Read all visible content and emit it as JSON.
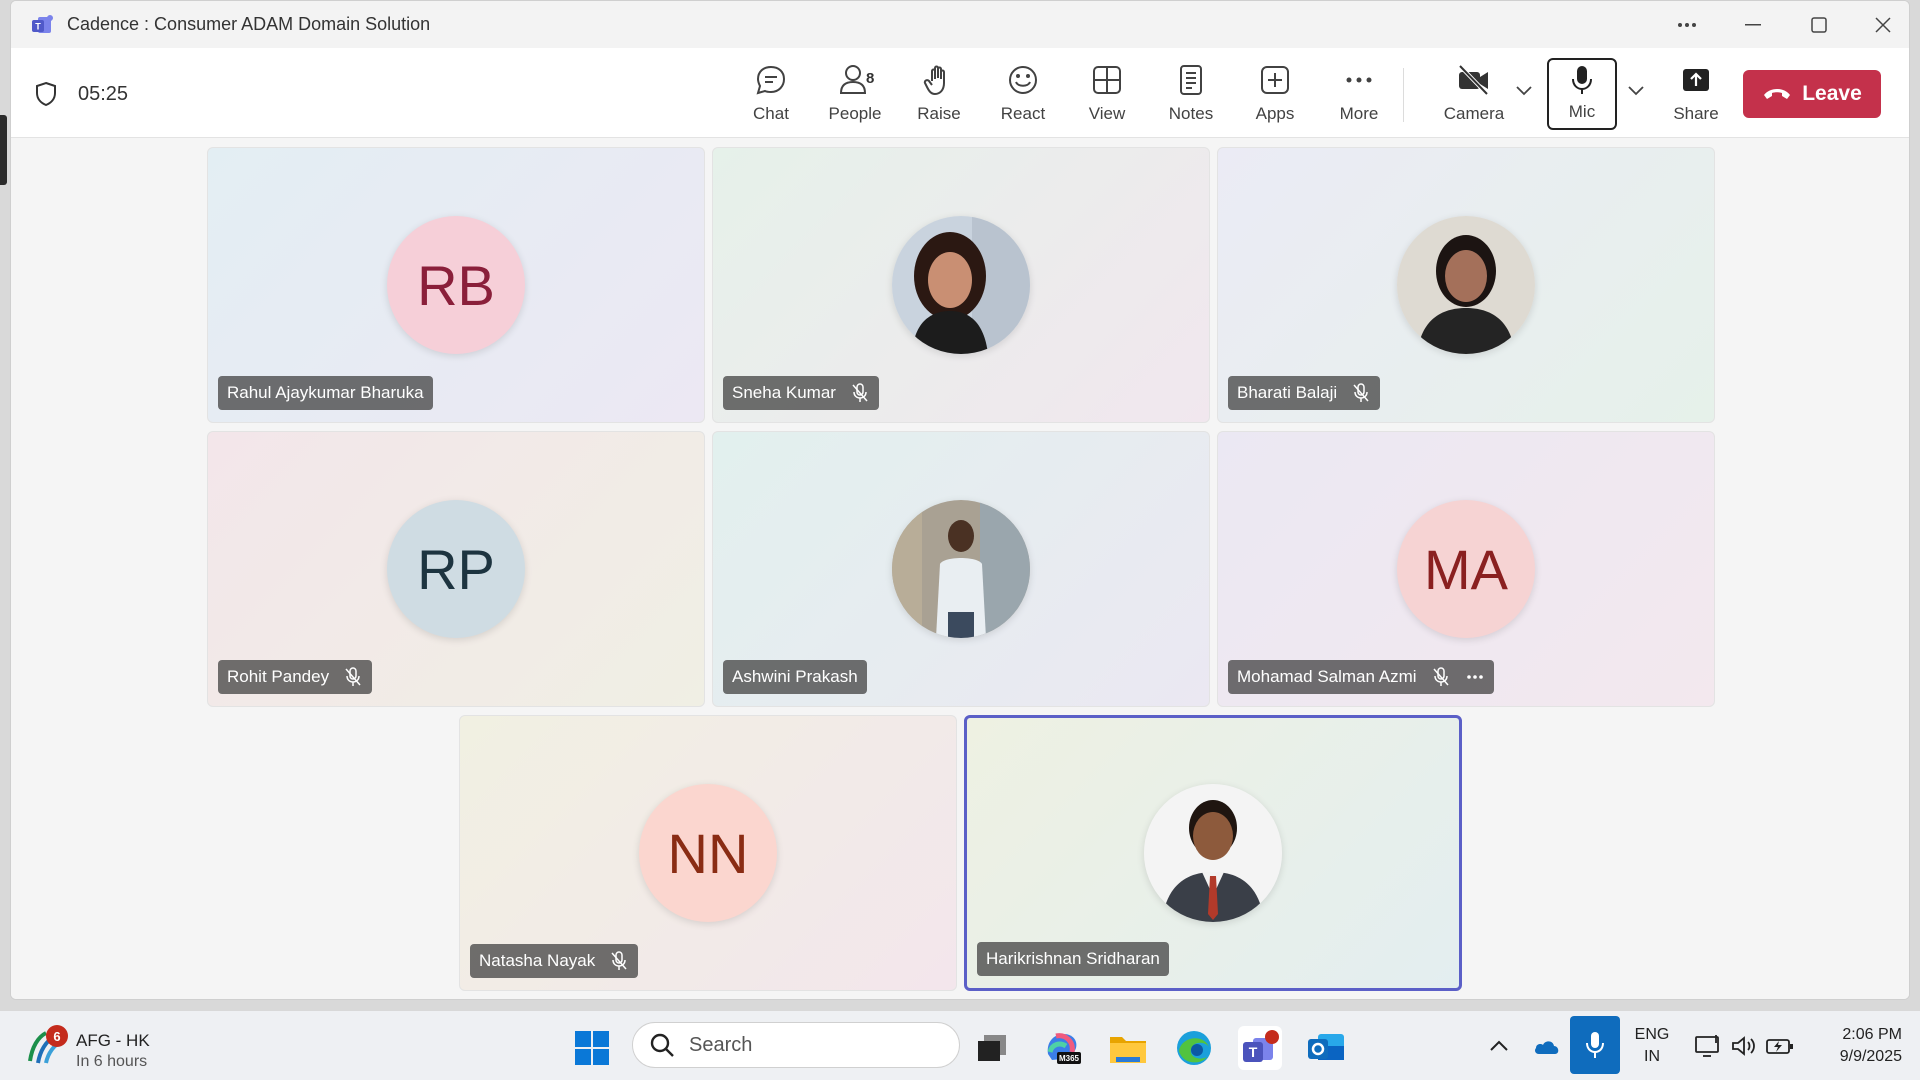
{
  "window": {
    "title": "Cadence : Consumer ADAM Domain Solution"
  },
  "meeting": {
    "timer": "05:25"
  },
  "toolbar": {
    "chat": "Chat",
    "people": "People",
    "people_count": "8",
    "raise": "Raise",
    "react": "React",
    "view": "View",
    "notes": "Notes",
    "apps": "Apps",
    "more": "More",
    "camera": "Camera",
    "mic": "Mic",
    "share": "Share",
    "leave": "Leave"
  },
  "participants": [
    {
      "name": "Rahul Ajaykumar Bharuka",
      "initials": "RB",
      "muted": false,
      "photo": false,
      "avatar_bg": "#f6cfd8",
      "avatar_fg": "#8a1f3a"
    },
    {
      "name": "Sneha Kumar",
      "initials": "",
      "muted": true,
      "photo": true
    },
    {
      "name": "Bharati Balaji",
      "initials": "",
      "muted": true,
      "photo": true
    },
    {
      "name": "Rohit Pandey",
      "initials": "RP",
      "muted": true,
      "photo": false,
      "avatar_bg": "#cfdce3",
      "avatar_fg": "#1d3440"
    },
    {
      "name": "Ashwini Prakash",
      "initials": "",
      "muted": false,
      "photo": true
    },
    {
      "name": "Mohamad Salman Azmi",
      "initials": "MA",
      "muted": true,
      "photo": false,
      "avatar_bg": "#f6d3d3",
      "avatar_fg": "#8a2020"
    },
    {
      "name": "Natasha Nayak",
      "initials": "NN",
      "muted": true,
      "photo": false,
      "avatar_bg": "#fbd6cf",
      "avatar_fg": "#8a2c14"
    },
    {
      "name": "Harikrishnan Sridharan",
      "initials": "",
      "muted": false,
      "photo": true,
      "active_speaker": true
    }
  ],
  "taskbar": {
    "weather_title": "AFG - HK",
    "weather_sub": "In 6 hours",
    "weather_badge": "6",
    "search_placeholder": "Search",
    "m365_label": "M365",
    "lang_line1": "ENG",
    "lang_line2": "IN",
    "time": "2:06 PM",
    "date": "9/9/2025"
  },
  "colors": {
    "leave_red": "#c4314b",
    "active_border": "#5b5fc7",
    "mic_active_blue": "#0f6cbd"
  }
}
